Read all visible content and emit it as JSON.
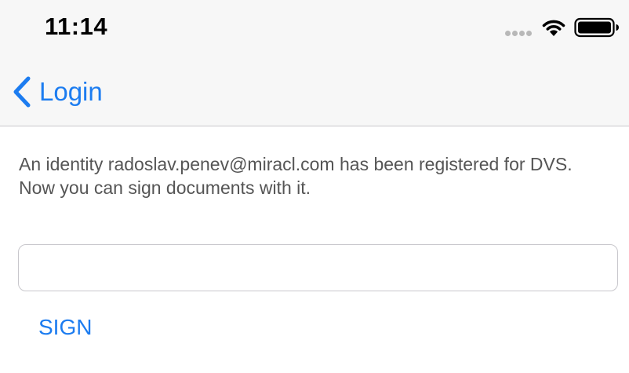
{
  "status_bar": {
    "time": "11:14",
    "icons": [
      "signal-dots-icon",
      "wifi-icon",
      "battery-icon"
    ]
  },
  "nav_bar": {
    "back_label": "Login",
    "back_icon": "chevron-left-icon"
  },
  "main": {
    "message": "An identity radoslav.penev@miracl.com has been registered for DVS. Now you can sign documents with it.",
    "input": {
      "value": "",
      "placeholder": ""
    },
    "sign_label": "SIGN"
  },
  "colors": {
    "accent": "#1c7cf0",
    "bar_background": "#f7f7f7",
    "text_secondary": "#555555",
    "separator": "#c8c7cc"
  }
}
